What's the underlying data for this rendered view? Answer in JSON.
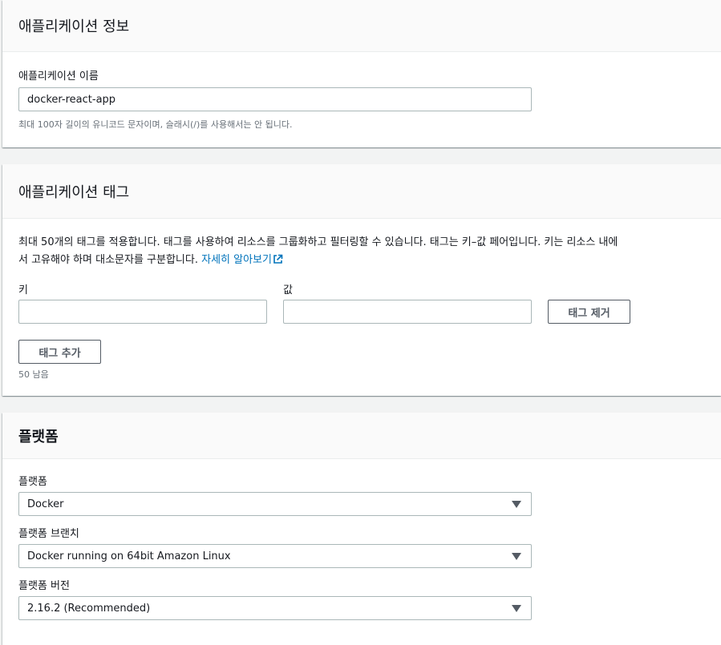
{
  "app_info": {
    "title": "애플리케이션 정보",
    "name_label": "애플리케이션 이름",
    "name_value": "docker-react-app",
    "name_hint": "최대 100자 길이의 유니코드 문자이며, 슬래시(/)를 사용해서는 안 됩니다."
  },
  "app_tags": {
    "title": "애플리케이션 태그",
    "description_line1": "최대 50개의 태그를 적용합니다. 태그를 사용하여 리소스를 그룹화하고 필터링할 수 있습니다. 태그는 키–값 페어입니다. 키는 리소스 내에",
    "description_line2": "서 고유해야 하며 대소문자를 구분합니다.",
    "learn_more_link": "자세히 알아보기",
    "key_label": "키",
    "value_label": "값",
    "key_value": "",
    "value_value": "",
    "remove_tag_label": "태그 제거",
    "add_tag_label": "태그 추가",
    "remaining": "50 남음"
  },
  "platform": {
    "title": "플랫폼",
    "platform_label": "플랫폼",
    "platform_value": "Docker",
    "branch_label": "플랫폼 브랜치",
    "branch_value": "Docker running on 64bit Amazon Linux",
    "version_label": "플랫폼 버전",
    "version_value": "2.16.2 (Recommended)"
  },
  "colors": {
    "link": "#0073bb",
    "border": "#aab7b8",
    "button_border": "#545b64",
    "header_bg": "#fafafa",
    "page_bg": "#f2f3f3"
  },
  "icons": {
    "external_link": "external-link-icon",
    "dropdown": "caret-down-icon"
  }
}
